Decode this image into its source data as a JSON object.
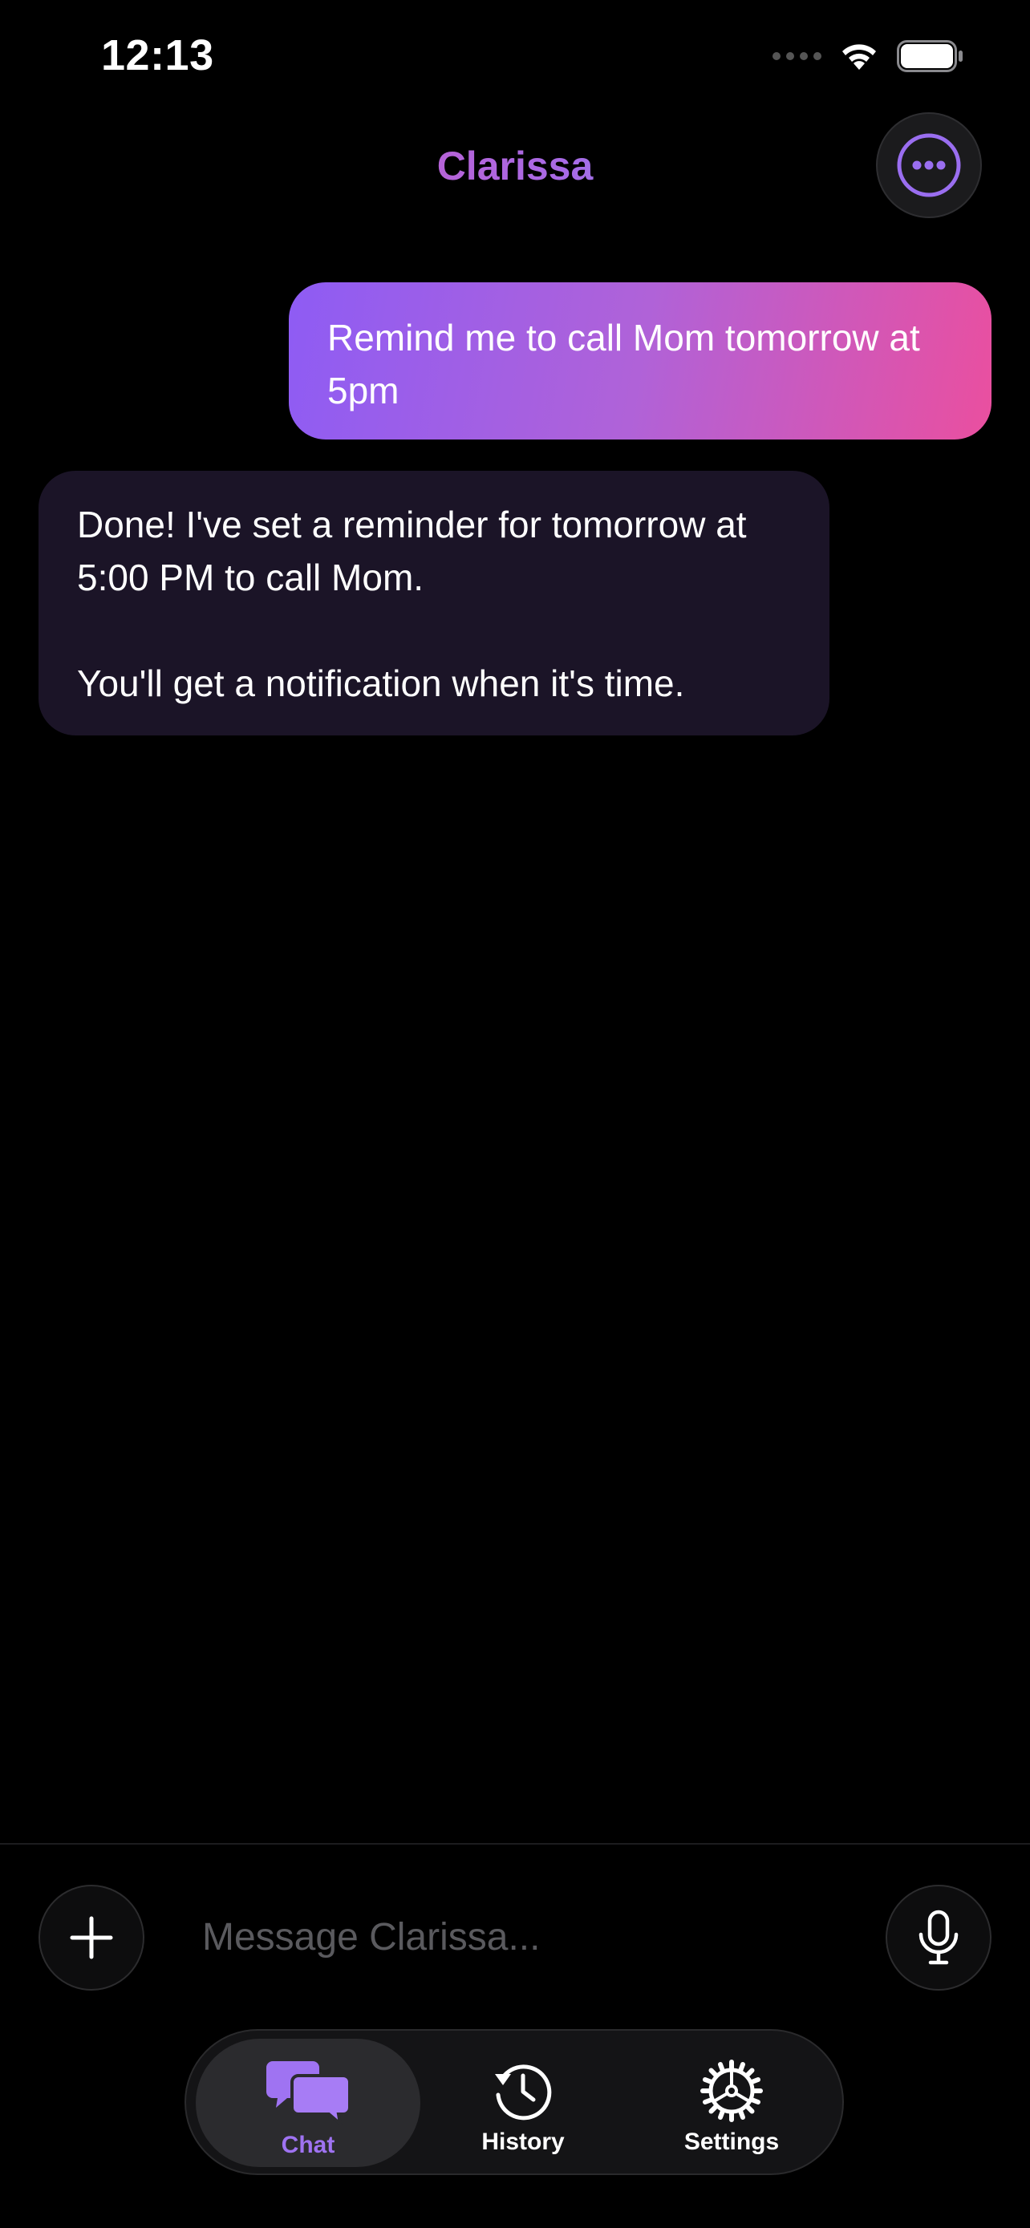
{
  "status_bar": {
    "time": "12:13"
  },
  "header": {
    "title": "Clarissa"
  },
  "messages": [
    {
      "role": "user",
      "text": "Remind me to call Mom tomorrow at 5pm"
    },
    {
      "role": "assistant",
      "paragraphs": [
        "Done! I've set a reminder for tomorrow at 5:00 PM to call Mom.",
        "You'll get a notification when it's time."
      ]
    }
  ],
  "composer": {
    "placeholder": "Message Clarissa..."
  },
  "tabs": [
    {
      "label": "Chat",
      "icon": "chat-bubbles-icon",
      "active": true
    },
    {
      "label": "History",
      "icon": "history-icon",
      "active": false
    },
    {
      "label": "Settings",
      "icon": "gear-icon",
      "active": false
    }
  ],
  "colors": {
    "accent": "#9f73f2",
    "user_bubble_start": "#8e5cf4",
    "user_bubble_end": "#ea4f9f",
    "assistant_bubble": "#1b1427",
    "background": "#000000"
  }
}
